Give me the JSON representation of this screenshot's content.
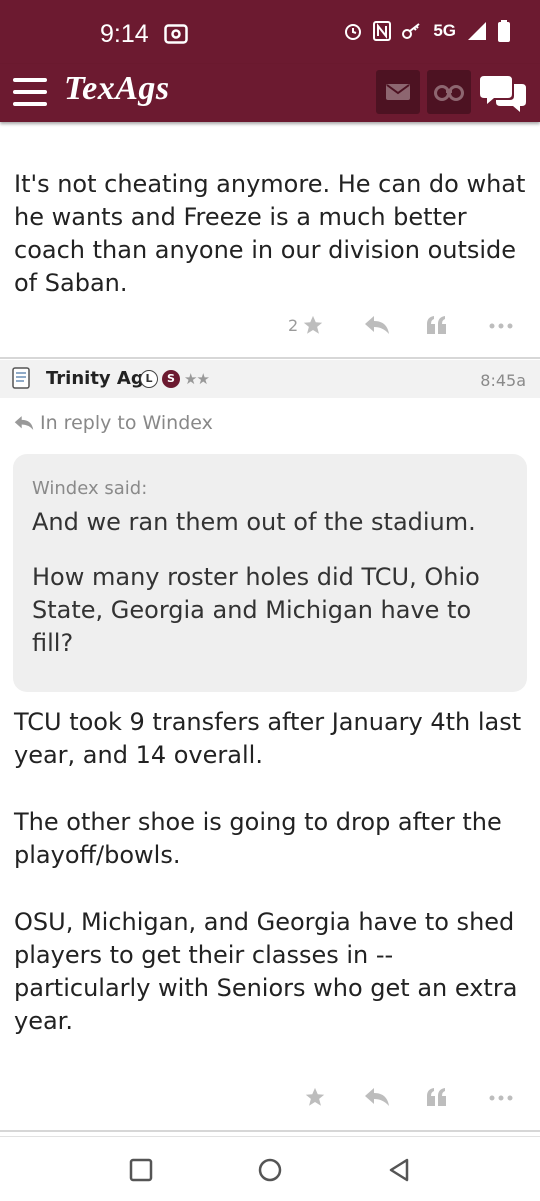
{
  "status": {
    "time": "9:14",
    "network": "5G"
  },
  "app": {
    "logo": "TexAgs"
  },
  "post1": {
    "text": "It's not cheating anymore. He can do what he wants and Freeze is a much better coach than anyone in our division outside of Saban.",
    "star_count": "2"
  },
  "post2": {
    "author": "Trinity Ag",
    "badge_l": "L",
    "badge_s": "S",
    "stars": "★★",
    "time": "8:45a",
    "reply_to": "In reply to Windex",
    "quote": {
      "author": "Windex said:",
      "lines": [
        "And we ran them out of the stadium.",
        "How many roster holes did TCU, Ohio State, Georgia and Michigan have to fill?"
      ]
    },
    "paragraphs": [
      "TCU took 9 transfers after January 4th last year, and 14 overall.",
      "The other shoe is going to drop after the playoff/bowls.",
      "OSU, Michigan, and Georgia have to shed players to get their classes in -- particularly with Seniors who get an extra year."
    ]
  },
  "colors": {
    "brand": "#6c1a30",
    "brand_dark": "#4d1222",
    "header_bg": "#f2f2f2",
    "quote_bg": "#efefef"
  },
  "icons": [
    "menu-icon",
    "mail-icon",
    "binoculars-icon",
    "chat-icon",
    "star-icon",
    "reply-icon",
    "quote-icon",
    "more-icon",
    "document-icon",
    "back-icon",
    "home-icon",
    "recents-icon"
  ]
}
